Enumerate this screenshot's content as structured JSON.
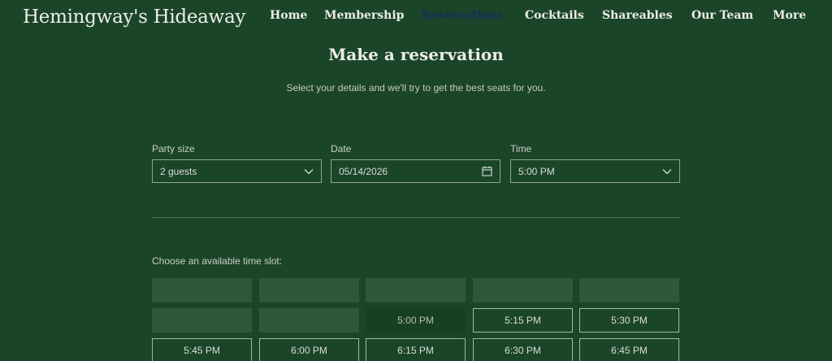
{
  "header": {
    "logo": "Hemingway's Hideaway",
    "nav": [
      {
        "label": "Home",
        "active": false
      },
      {
        "label": "Membership",
        "active": false
      },
      {
        "label": "Reservations",
        "active": true
      },
      {
        "label": "Cocktails",
        "active": false
      },
      {
        "label": "Shareables",
        "active": false
      },
      {
        "label": "Our Team",
        "active": false
      },
      {
        "label": "More",
        "active": false
      }
    ]
  },
  "reservation": {
    "title": "Make a reservation",
    "subtitle": "Select your details and we'll try to get the best seats for you.",
    "party_size": {
      "label": "Party size",
      "value": "2 guests"
    },
    "date": {
      "label": "Date",
      "value": "05/14/2026"
    },
    "time": {
      "label": "Time",
      "value": "5:00 PM"
    },
    "slots_label": "Choose an available time slot:",
    "slots": [
      {
        "label": "",
        "state": "disabled"
      },
      {
        "label": "",
        "state": "disabled"
      },
      {
        "label": "",
        "state": "disabled"
      },
      {
        "label": "",
        "state": "disabled"
      },
      {
        "label": "",
        "state": "disabled"
      },
      {
        "label": "",
        "state": "disabled"
      },
      {
        "label": "",
        "state": "disabled"
      },
      {
        "label": "5:00 PM",
        "state": "selected"
      },
      {
        "label": "5:15 PM",
        "state": "available"
      },
      {
        "label": "5:30 PM",
        "state": "available"
      },
      {
        "label": "5:45 PM",
        "state": "available"
      },
      {
        "label": "6:00 PM",
        "state": "available"
      },
      {
        "label": "6:15 PM",
        "state": "available"
      },
      {
        "label": "6:30 PM",
        "state": "available"
      },
      {
        "label": "6:45 PM",
        "state": "available"
      }
    ]
  },
  "colors": {
    "background": "#1b4528",
    "nav_active": "#12305a",
    "slot_disabled": "#2f5739",
    "slot_border": "#a5b5a6"
  }
}
